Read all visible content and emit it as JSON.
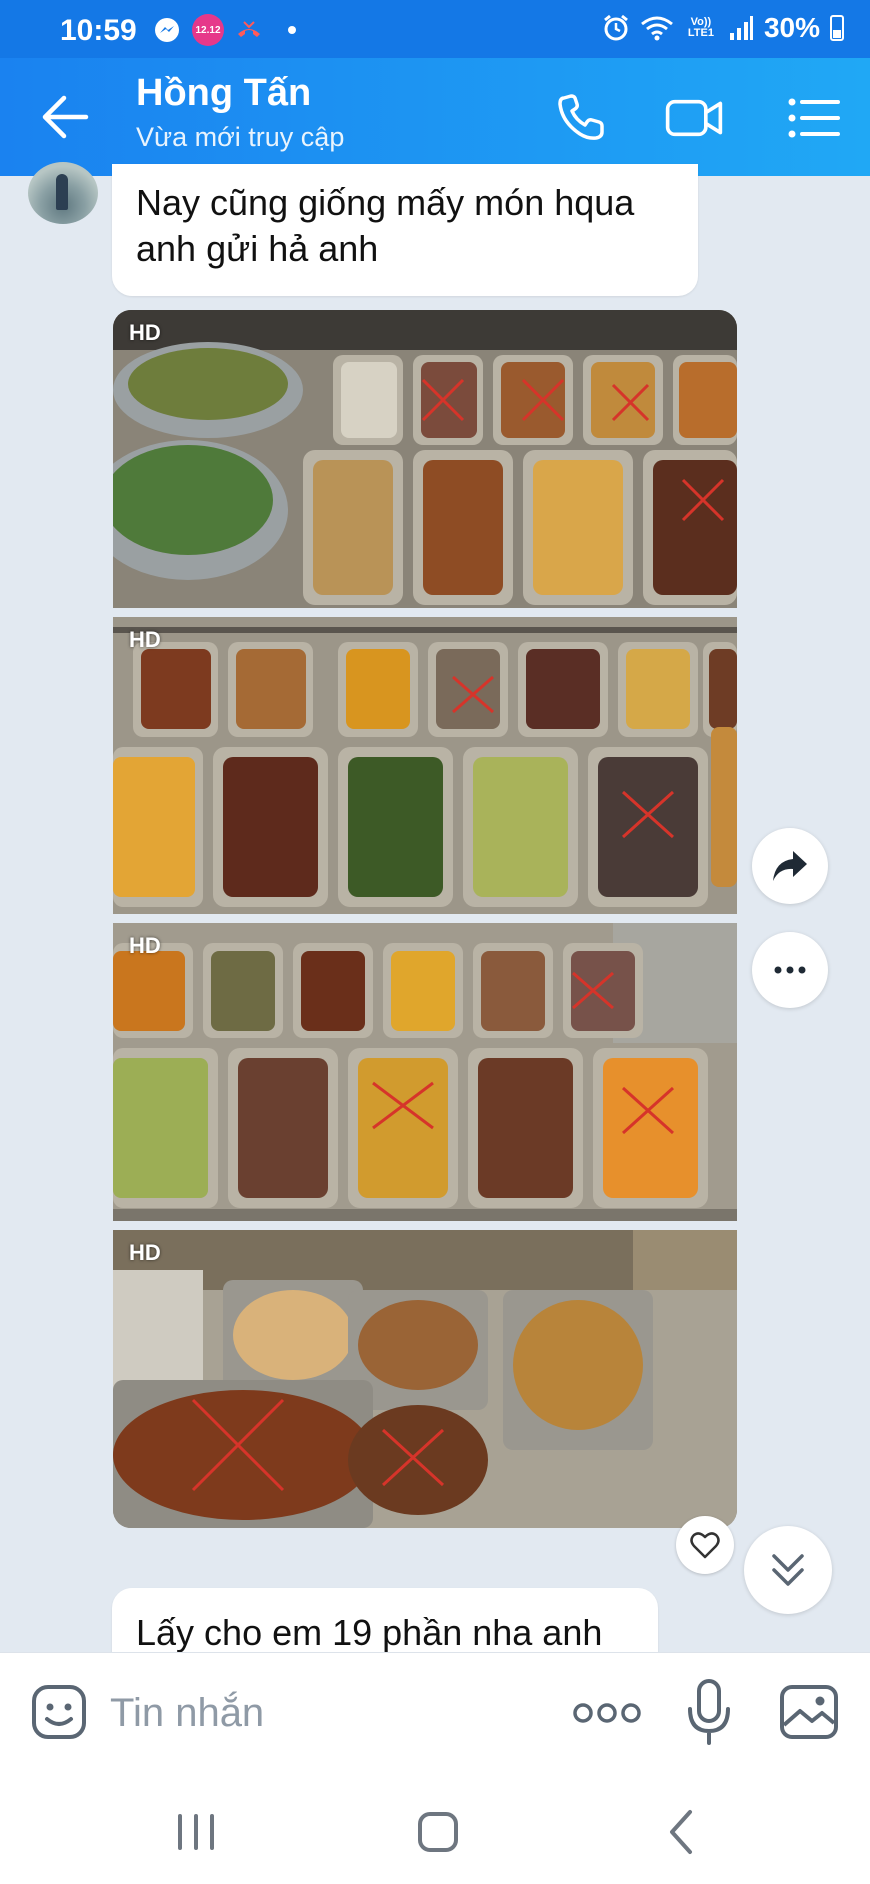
{
  "status_bar": {
    "time": "10:59",
    "lazada_badge": "12.12",
    "battery": "30%",
    "network": "Vo)) LTE1"
  },
  "header": {
    "contact_name": "Hồng Tấn",
    "contact_status": "Vừa mới truy cập"
  },
  "messages": [
    {
      "text": "Nay cũng giống mấy món hqua anh gửi hả anh"
    },
    {
      "photo_label": "HD"
    },
    {
      "photo_label": "HD"
    },
    {
      "photo_label": "HD"
    },
    {
      "photo_label": "HD"
    },
    {
      "text": "Lấy cho em 19 phần nha anh"
    }
  ],
  "input": {
    "placeholder": "Tin nhắn"
  },
  "colors": {
    "header": "#1a82f0",
    "chat_bg": "#e2e9f1",
    "icon": "#5a6673"
  }
}
